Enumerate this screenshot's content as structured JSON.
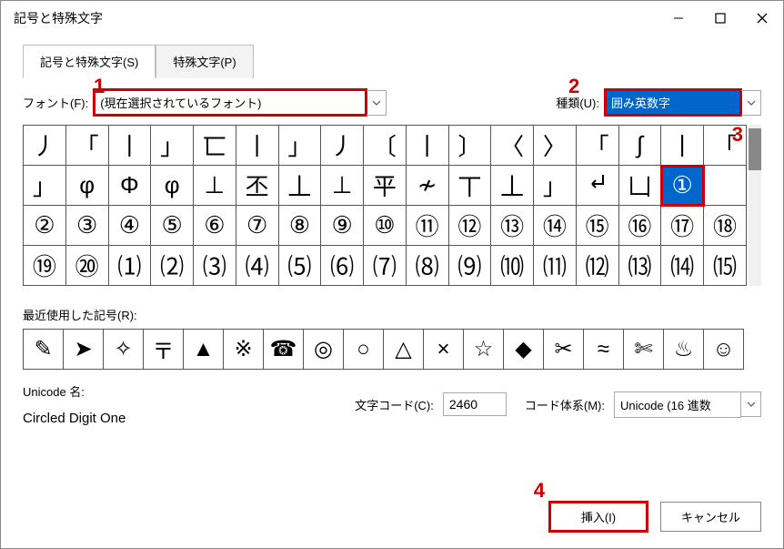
{
  "window": {
    "title": "記号と特殊文字"
  },
  "tabs": {
    "symbols": "記号と特殊文字(S)",
    "special": "特殊文字(P)"
  },
  "font": {
    "label": "フォント(F):",
    "value": "(現在選択されているフォント)"
  },
  "subset": {
    "label": "種類(U):",
    "value": "囲み英数字"
  },
  "callouts": {
    "c1": "1",
    "c2": "2",
    "c3": "3",
    "c4": "4"
  },
  "grid": {
    "row0": [
      "丿",
      "「",
      "丨",
      "」",
      "匸",
      "丨",
      "」",
      "丿",
      "〔",
      "丨",
      "〕",
      "〈",
      "〉",
      "「",
      "∫",
      "丨",
      "「"
    ],
    "row1": [
      "」",
      "φ",
      "Φ",
      "φ",
      "⊥",
      "丕",
      "丄",
      "⊥",
      "平",
      "≁",
      "丅",
      "丄",
      "」",
      "↵",
      "凵",
      "①"
    ],
    "row2": [
      "②",
      "③",
      "④",
      "⑤",
      "⑥",
      "⑦",
      "⑧",
      "⑨",
      "⑩",
      "⑪",
      "⑫",
      "⑬",
      "⑭",
      "⑮",
      "⑯",
      "⑰",
      "⑱"
    ],
    "row3": [
      "⑲",
      "⑳",
      "⑴",
      "⑵",
      "⑶",
      "⑷",
      "⑸",
      "⑹",
      "⑺",
      "⑻",
      "⑼",
      "⑽",
      "⑾",
      "⑿",
      "⒀",
      "⒁",
      "⒂"
    ]
  },
  "recent": {
    "label": "最近使用した記号(R):",
    "items": [
      "✎",
      "➤",
      "✧",
      "〒",
      "▲",
      "※",
      "☎",
      "◎",
      "○",
      "△",
      "×",
      "☆",
      "◆",
      "✂",
      "≈",
      "✄",
      "♨",
      "☺"
    ]
  },
  "unicode": {
    "label": "Unicode 名:",
    "name": "Circled Digit One"
  },
  "charcode": {
    "label": "文字コード(C):",
    "value": "2460"
  },
  "codesystem": {
    "label": "コード体系(M):",
    "value": "Unicode (16 進数"
  },
  "buttons": {
    "insert": "挿入(I)",
    "cancel": "キャンセル"
  }
}
